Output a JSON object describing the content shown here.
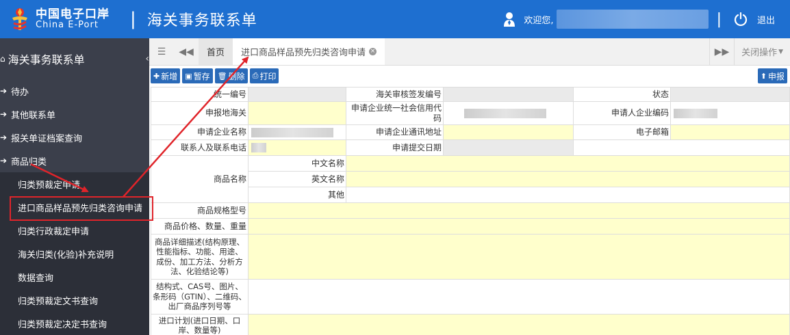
{
  "header": {
    "logo_cn": "中国电子口岸",
    "logo_en": "China E-Port",
    "separator": "|",
    "title": "海关事务联系单",
    "welcome": "欢迎您,",
    "separator2": "|",
    "logout": "退出",
    "colors": {
      "bg": "#1e6fd0"
    }
  },
  "sidebar": {
    "title": "海关事务联系单",
    "items": [
      {
        "label": "待办"
      },
      {
        "label": "其他联系单"
      },
      {
        "label": "报关单证档案查询"
      },
      {
        "label": "商品归类"
      }
    ],
    "sub_items": [
      {
        "label": "归类预裁定申请"
      },
      {
        "label": "进口商品样品预先归类咨询申请"
      },
      {
        "label": "归类行政裁定申请"
      },
      {
        "label": "海关归类(化验)补充说明"
      },
      {
        "label": "数据查询"
      },
      {
        "label": "归类预裁定文书查询"
      },
      {
        "label": "归类预裁定决定书查询"
      }
    ]
  },
  "tabs": {
    "home": "首页",
    "active": "进口商品样品预先归类咨询申请",
    "close_ops": "关闭操作"
  },
  "toolbar": {
    "add": "新增",
    "save": "暂存",
    "delete": "删除",
    "print": "打印",
    "submit": "申报"
  },
  "form": {
    "unified_no": "统一编号",
    "customs_sign_no": "海关审核签发编号",
    "status": "状态",
    "declare_customs": "申报地海关",
    "credit_code": "申请企业统一社会信用代码",
    "applicant_code": "申请人企业编码",
    "company_name": "申请企业名称",
    "company_address": "申请企业通讯地址",
    "email": "电子邮箱",
    "contact": "联系人及联系电话",
    "submit_date": "申请提交日期",
    "goods_name": "商品名称",
    "cn_name": "中文名称",
    "en_name": "英文名称",
    "other": "其他",
    "spec_model": "商品规格型号",
    "price_qty_weight": "商品价格、数量、重量",
    "detail_desc": "商品详细描述(结构原理、性能指标、功能、用途、成份、加工方法、分析方法、化验结论等)",
    "structure": "结构式、CAS号、图片、条形码（GTIN）、二维码、出厂商品序列号等",
    "import_plan": "进口计划(进口日期、口岸、数量等)"
  }
}
